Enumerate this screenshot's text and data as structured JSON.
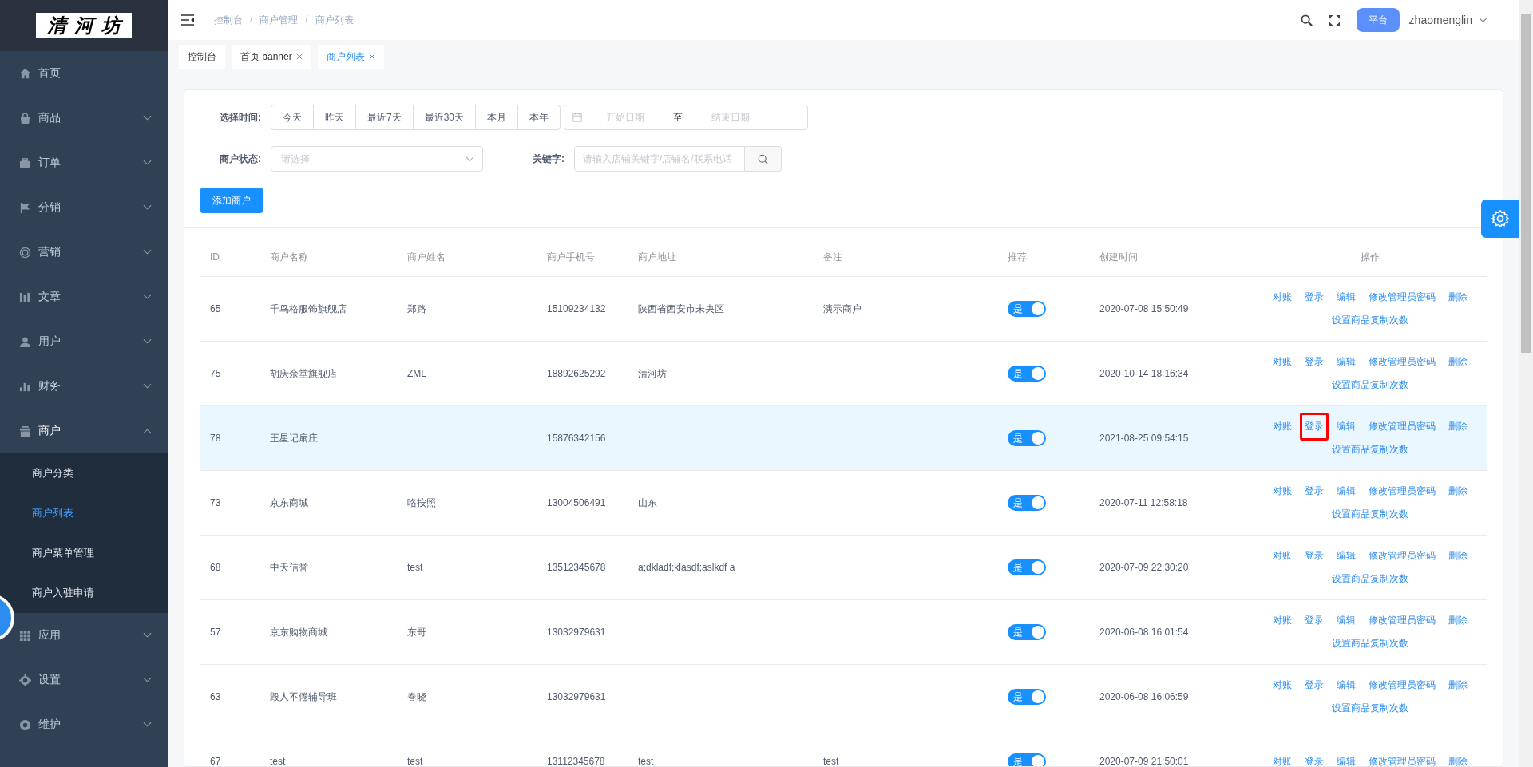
{
  "sidebar": {
    "logo": "清河坊",
    "menu": [
      {
        "label": "首页"
      },
      {
        "label": "商品",
        "expanded": false
      },
      {
        "label": "订单",
        "expanded": false
      },
      {
        "label": "分销",
        "expanded": false
      },
      {
        "label": "营销",
        "expanded": false
      },
      {
        "label": "文章",
        "expanded": false
      },
      {
        "label": "用户",
        "expanded": false
      },
      {
        "label": "财务",
        "expanded": false
      },
      {
        "label": "商户",
        "expanded": true,
        "children": [
          {
            "label": "商户分类",
            "selected": false
          },
          {
            "label": "商户列表",
            "selected": true
          },
          {
            "label": "商户菜单管理",
            "selected": false
          },
          {
            "label": "商户入驻申请",
            "selected": false
          }
        ]
      },
      {
        "label": "应用",
        "expanded": false
      },
      {
        "label": "设置",
        "expanded": false
      },
      {
        "label": "维护",
        "expanded": false
      }
    ]
  },
  "header": {
    "breadcrumb": [
      "控制台",
      "商户管理",
      "商户列表"
    ],
    "breadcrumb_separator": "/",
    "platform_button": "平台",
    "user": "zhaomenglin"
  },
  "tags": [
    {
      "label": "控制台",
      "closable": false,
      "selected": false
    },
    {
      "label": "首页 banner",
      "closable": true,
      "selected": false
    },
    {
      "label": "商户列表",
      "closable": true,
      "selected": true
    }
  ],
  "filters": {
    "time_label": "选择时间:",
    "time_options": [
      {
        "label": "今天",
        "selected": false
      },
      {
        "label": "昨天",
        "selected": false
      },
      {
        "label": "最近7天",
        "selected": false
      },
      {
        "label": "最近30天",
        "selected": false
      },
      {
        "label": "本月",
        "selected": false
      },
      {
        "label": "本年",
        "selected": false
      }
    ],
    "start_placeholder": "开始日期",
    "range_separator": "至",
    "end_placeholder": "结束日期",
    "status_label": "商户状态:",
    "status_placeholder": "请选择",
    "keyword_label": "关键字:",
    "keyword_placeholder": "请输入店铺关键字/店铺名/联系电话"
  },
  "add_button": "添加商户",
  "table": {
    "columns": [
      "ID",
      "商户名称",
      "商户姓名",
      "商户手机号",
      "商户地址",
      "备注",
      "推荐",
      "创建时间",
      "操作"
    ],
    "rows": [
      {
        "id": "65",
        "name": "千鸟格服饰旗舰店",
        "contact": "郑路",
        "phone": "15109234132",
        "address": "陕西省西安市未央区",
        "note": "演示商户",
        "recommend": {
          "on": true,
          "label": "是"
        },
        "created": "2020-07-08 15:50:49",
        "selected": false,
        "actions": [
          {
            "label": "对账",
            "highlighted": false
          },
          {
            "label": "登录",
            "highlighted": false
          },
          {
            "label": "编辑",
            "highlighted": false
          },
          {
            "label": "修改管理员密码",
            "highlighted": false
          },
          {
            "label": "删除",
            "highlighted": false
          },
          {
            "label": "设置商品复制次数",
            "highlighted": false
          }
        ]
      },
      {
        "id": "75",
        "name": "胡庆余堂旗舰店",
        "contact": "ZML",
        "phone": "18892625292",
        "address": "清河坊",
        "note": "",
        "recommend": {
          "on": true,
          "label": "是"
        },
        "created": "2020-10-14 18:16:34",
        "selected": false,
        "actions": [
          {
            "label": "对账",
            "highlighted": false
          },
          {
            "label": "登录",
            "highlighted": false
          },
          {
            "label": "编辑",
            "highlighted": false
          },
          {
            "label": "修改管理员密码",
            "highlighted": false
          },
          {
            "label": "删除",
            "highlighted": false
          },
          {
            "label": "设置商品复制次数",
            "highlighted": false
          }
        ]
      },
      {
        "id": "78",
        "name": "王星记扇庄",
        "contact": "",
        "phone": "15876342156",
        "address": "",
        "note": "",
        "recommend": {
          "on": true,
          "label": "是"
        },
        "created": "2021-08-25 09:54:15",
        "selected": true,
        "actions": [
          {
            "label": "对账",
            "highlighted": false
          },
          {
            "label": "登录",
            "highlighted": true
          },
          {
            "label": "编辑",
            "highlighted": false
          },
          {
            "label": "修改管理员密码",
            "highlighted": false
          },
          {
            "label": "删除",
            "highlighted": false
          },
          {
            "label": "设置商品复制次数",
            "highlighted": false
          }
        ]
      },
      {
        "id": "73",
        "name": "京东商城",
        "contact": "咯按照",
        "phone": "13004506491",
        "address": "山东",
        "note": "",
        "recommend": {
          "on": true,
          "label": "是"
        },
        "created": "2020-07-11 12:58:18",
        "selected": false,
        "actions": [
          {
            "label": "对账",
            "highlighted": false
          },
          {
            "label": "登录",
            "highlighted": false
          },
          {
            "label": "编辑",
            "highlighted": false
          },
          {
            "label": "修改管理员密码",
            "highlighted": false
          },
          {
            "label": "删除",
            "highlighted": false
          },
          {
            "label": "设置商品复制次数",
            "highlighted": false
          }
        ]
      },
      {
        "id": "68",
        "name": "中天信誉",
        "contact": "test",
        "phone": "13512345678",
        "address": "a;dkladf;klasdf;aslkdf a",
        "note": "",
        "recommend": {
          "on": true,
          "label": "是"
        },
        "created": "2020-07-09 22:30:20",
        "selected": false,
        "actions": [
          {
            "label": "对账",
            "highlighted": false
          },
          {
            "label": "登录",
            "highlighted": false
          },
          {
            "label": "编辑",
            "highlighted": false
          },
          {
            "label": "修改管理员密码",
            "highlighted": false
          },
          {
            "label": "删除",
            "highlighted": false
          },
          {
            "label": "设置商品复制次数",
            "highlighted": false
          }
        ]
      },
      {
        "id": "57",
        "name": "京东购物商城",
        "contact": "东哥",
        "phone": "13032979631",
        "address": "",
        "note": "",
        "recommend": {
          "on": true,
          "label": "是"
        },
        "created": "2020-06-08 16:01:54",
        "selected": false,
        "actions": [
          {
            "label": "对账",
            "highlighted": false
          },
          {
            "label": "登录",
            "highlighted": false
          },
          {
            "label": "编辑",
            "highlighted": false
          },
          {
            "label": "修改管理员密码",
            "highlighted": false
          },
          {
            "label": "删除",
            "highlighted": false
          },
          {
            "label": "设置商品复制次数",
            "highlighted": false
          }
        ]
      },
      {
        "id": "63",
        "name": "毁人不倦辅导班",
        "contact": "春晓",
        "phone": "13032979631",
        "address": "",
        "note": "",
        "recommend": {
          "on": true,
          "label": "是"
        },
        "created": "2020-06-08 16:06:59",
        "selected": false,
        "actions": [
          {
            "label": "对账",
            "highlighted": false
          },
          {
            "label": "登录",
            "highlighted": false
          },
          {
            "label": "编辑",
            "highlighted": false
          },
          {
            "label": "修改管理员密码",
            "highlighted": false
          },
          {
            "label": "删除",
            "highlighted": false
          },
          {
            "label": "设置商品复制次数",
            "highlighted": false
          }
        ]
      },
      {
        "id": "67",
        "name": "test",
        "contact": "test",
        "phone": "13112345678",
        "address": "test",
        "note": "test",
        "recommend": {
          "on": true,
          "label": "是"
        },
        "created": "2020-07-09 21:50:01",
        "selected": false,
        "actions": [
          {
            "label": "对账",
            "highlighted": false
          },
          {
            "label": "登录",
            "highlighted": false
          },
          {
            "label": "编辑",
            "highlighted": false
          },
          {
            "label": "修改管理员密码",
            "highlighted": false
          },
          {
            "label": "删除",
            "highlighted": false
          }
        ]
      }
    ]
  }
}
